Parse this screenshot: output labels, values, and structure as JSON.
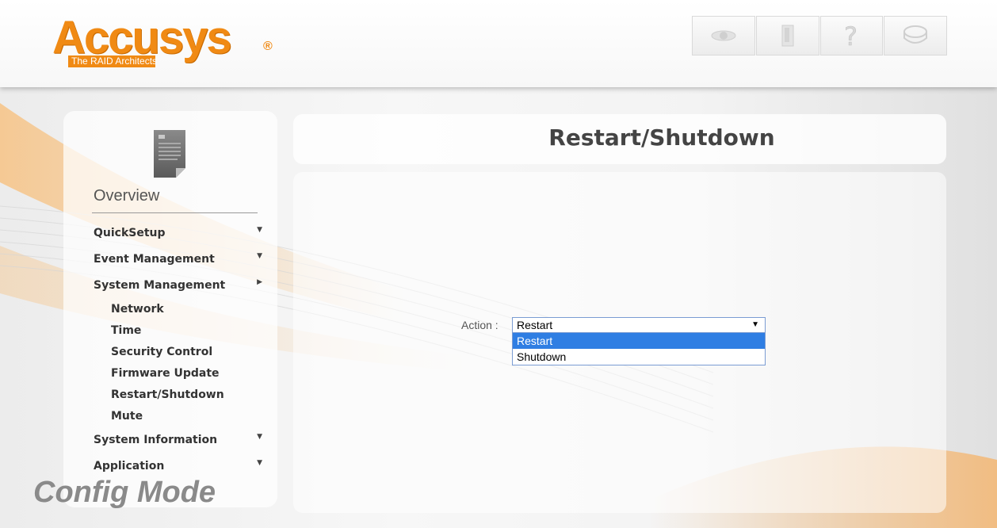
{
  "header": {
    "logo_word": "Accusys",
    "logo_registered": "®",
    "logo_tagline": "The RAID Architects",
    "toolbar": [
      "view-icon",
      "logout-door-icon",
      "help-icon",
      "disk-icon"
    ]
  },
  "sidebar": {
    "overview_label": "Overview",
    "menu": [
      {
        "label": "QuickSetup",
        "arrow": "▼"
      },
      {
        "label": "Event Management",
        "arrow": "▼"
      },
      {
        "label": "System Management",
        "arrow": "▶"
      }
    ],
    "submenu": [
      "Network",
      "Time",
      "Security Control",
      "Firmware Update",
      "Restart/Shutdown",
      "Mute"
    ],
    "menu_after": [
      {
        "label": "System Information",
        "arrow": "▼"
      },
      {
        "label": "Application",
        "arrow": "▼"
      }
    ],
    "mode_label": "Config Mode"
  },
  "main": {
    "title": "Restart/Shutdown",
    "action_label": "Action :",
    "select_value": "Restart",
    "select_caret": "▼",
    "options": [
      "Restart",
      "Shutdown"
    ]
  },
  "colors": {
    "brand": "#f08a14",
    "highlight": "#2f7ee3"
  }
}
